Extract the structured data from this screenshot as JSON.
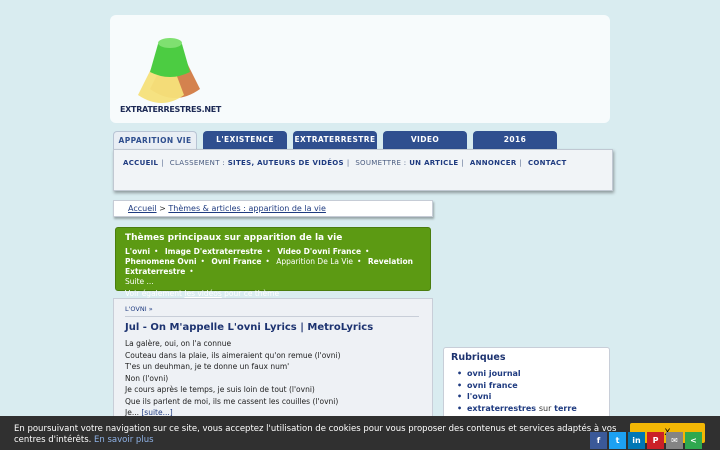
{
  "site": {
    "logo_text": "EXTRATERRESTRES.NET"
  },
  "tabs": [
    {
      "label": "APPARITION VIE",
      "active": true
    },
    {
      "label": "L'EXISTENCE",
      "active": false
    },
    {
      "label": "EXTRATERRESTRE",
      "active": false
    },
    {
      "label": "VIDEO",
      "active": false
    },
    {
      "label": "2016",
      "active": false
    }
  ],
  "subnav": {
    "accueil": "ACCUEIL",
    "classement_label": "CLASSEMENT :",
    "classement_link": "SITES, AUTEURS DE VIDÉOS",
    "soumettre_label": "SOUMETTRE :",
    "soumettre_link": "UN ARTICLE",
    "annoncer": "ANNONCER",
    "contact": "CONTACT"
  },
  "breadcrumb": {
    "home": "Accueil",
    "separator": ">",
    "current": "Thèmes & articles : apparition de la vie"
  },
  "themes": {
    "title": "Thèmes principaux sur apparition de la vie",
    "items": [
      "L'ovni",
      "Image D'extraterrestre",
      "Video D'ovni France",
      "Phenomene Ovni",
      "Ovni France",
      "Apparition De La Vie",
      "Revelation Extraterrestre"
    ],
    "more": "Suite ...",
    "also_prefix": "Voir également",
    "also_link": "les vidéos",
    "also_suffix": "pour ce thème"
  },
  "article": {
    "category": "L'OVNI »",
    "title": "Jul - On M'appelle L'ovni Lyrics | MetroLyrics",
    "lines": [
      "La galère, oui, on l'a connue",
      "Couteau dans la plaie, ils aimeraient qu'on remue (l'ovni)",
      "T'es un deuhman, je te donne un faux num'",
      "Non (l'ovni)",
      "Je cours après le temps, je suis loin de tout (l'ovni)",
      "Que ils parlent de moi, ils me cassent les couilles (l'ovni)",
      "Je..."
    ],
    "more": "[suite...]"
  },
  "rubriques": {
    "title": "Rubriques",
    "items": [
      {
        "bold": "ovni journal",
        "plain": "",
        "bold2": ""
      },
      {
        "bold": "ovni france",
        "plain": "",
        "bold2": ""
      },
      {
        "bold": "l'ovni",
        "plain": "",
        "bold2": ""
      },
      {
        "bold": "extraterrestres",
        "plain": "sur",
        "bold2": "terre"
      }
    ]
  },
  "cookie": {
    "text": "En poursuivant votre navigation sur ce site, vous acceptez l'utilisation de cookies pour vous proposer des contenus et services adaptés à vos centres d'intérêts.",
    "link": "En savoir plus",
    "button": "X"
  },
  "share": {
    "facebook": "f",
    "twitter": "t",
    "linkedin": "in",
    "pinterest": "P",
    "email": "✉",
    "share": "<"
  },
  "colors": {
    "tab_blue": "#2f4f8f",
    "themes_green": "#5c9a13",
    "cookie_button": "#f2b705"
  }
}
